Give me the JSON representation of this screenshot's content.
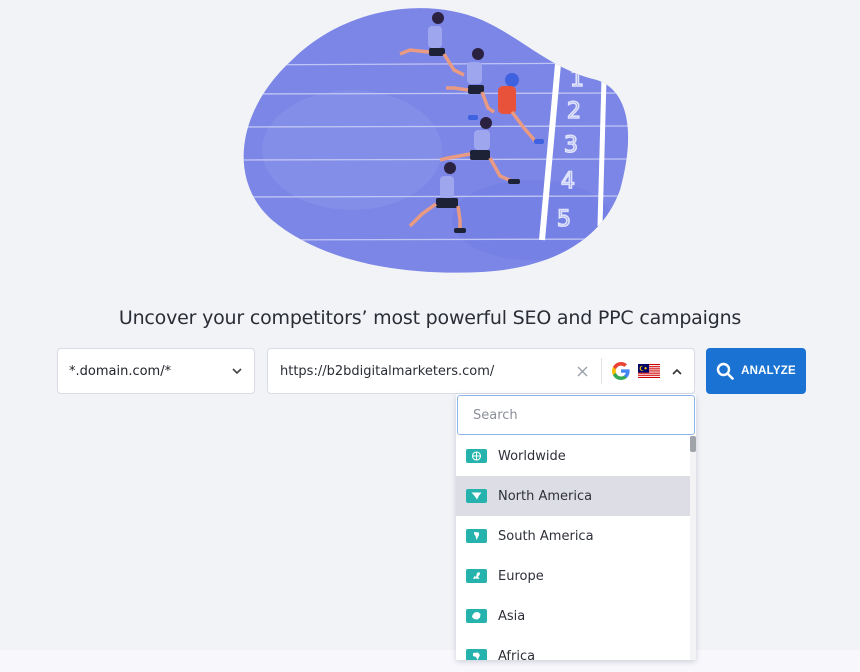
{
  "hero": {
    "image_alt": "Runners crossing finish line",
    "lane_numbers": [
      "1",
      "2",
      "3",
      "4",
      "5"
    ]
  },
  "headline": "Uncover your competitors’ most powerful SEO and PPC campaigns",
  "mode_select": {
    "value": "*.domain.com/*",
    "icon": "chevron-down-icon"
  },
  "url_input": {
    "value": "https://b2bdigitalmarketers.com/",
    "clear_icon": "close-icon",
    "search_engine_icon": "google-icon",
    "country_flag_icon": "malaysia-flag-icon",
    "toggle_icon": "chevron-up-icon"
  },
  "analyze_button": {
    "label": "ANALYZE",
    "icon": "search-icon",
    "color": "#1a73d2"
  },
  "dropdown": {
    "search_placeholder": "Search",
    "accent_color": "#27b3ad",
    "items": [
      {
        "label": "Worldwide",
        "icon": "globe-icon",
        "active": false
      },
      {
        "label": "North America",
        "icon": "north-america-icon",
        "active": true
      },
      {
        "label": "South America",
        "icon": "south-america-icon",
        "active": false
      },
      {
        "label": "Europe",
        "icon": "europe-icon",
        "active": false
      },
      {
        "label": "Asia",
        "icon": "asia-icon",
        "active": false
      },
      {
        "label": "Africa",
        "icon": "africa-icon",
        "active": false
      }
    ]
  }
}
